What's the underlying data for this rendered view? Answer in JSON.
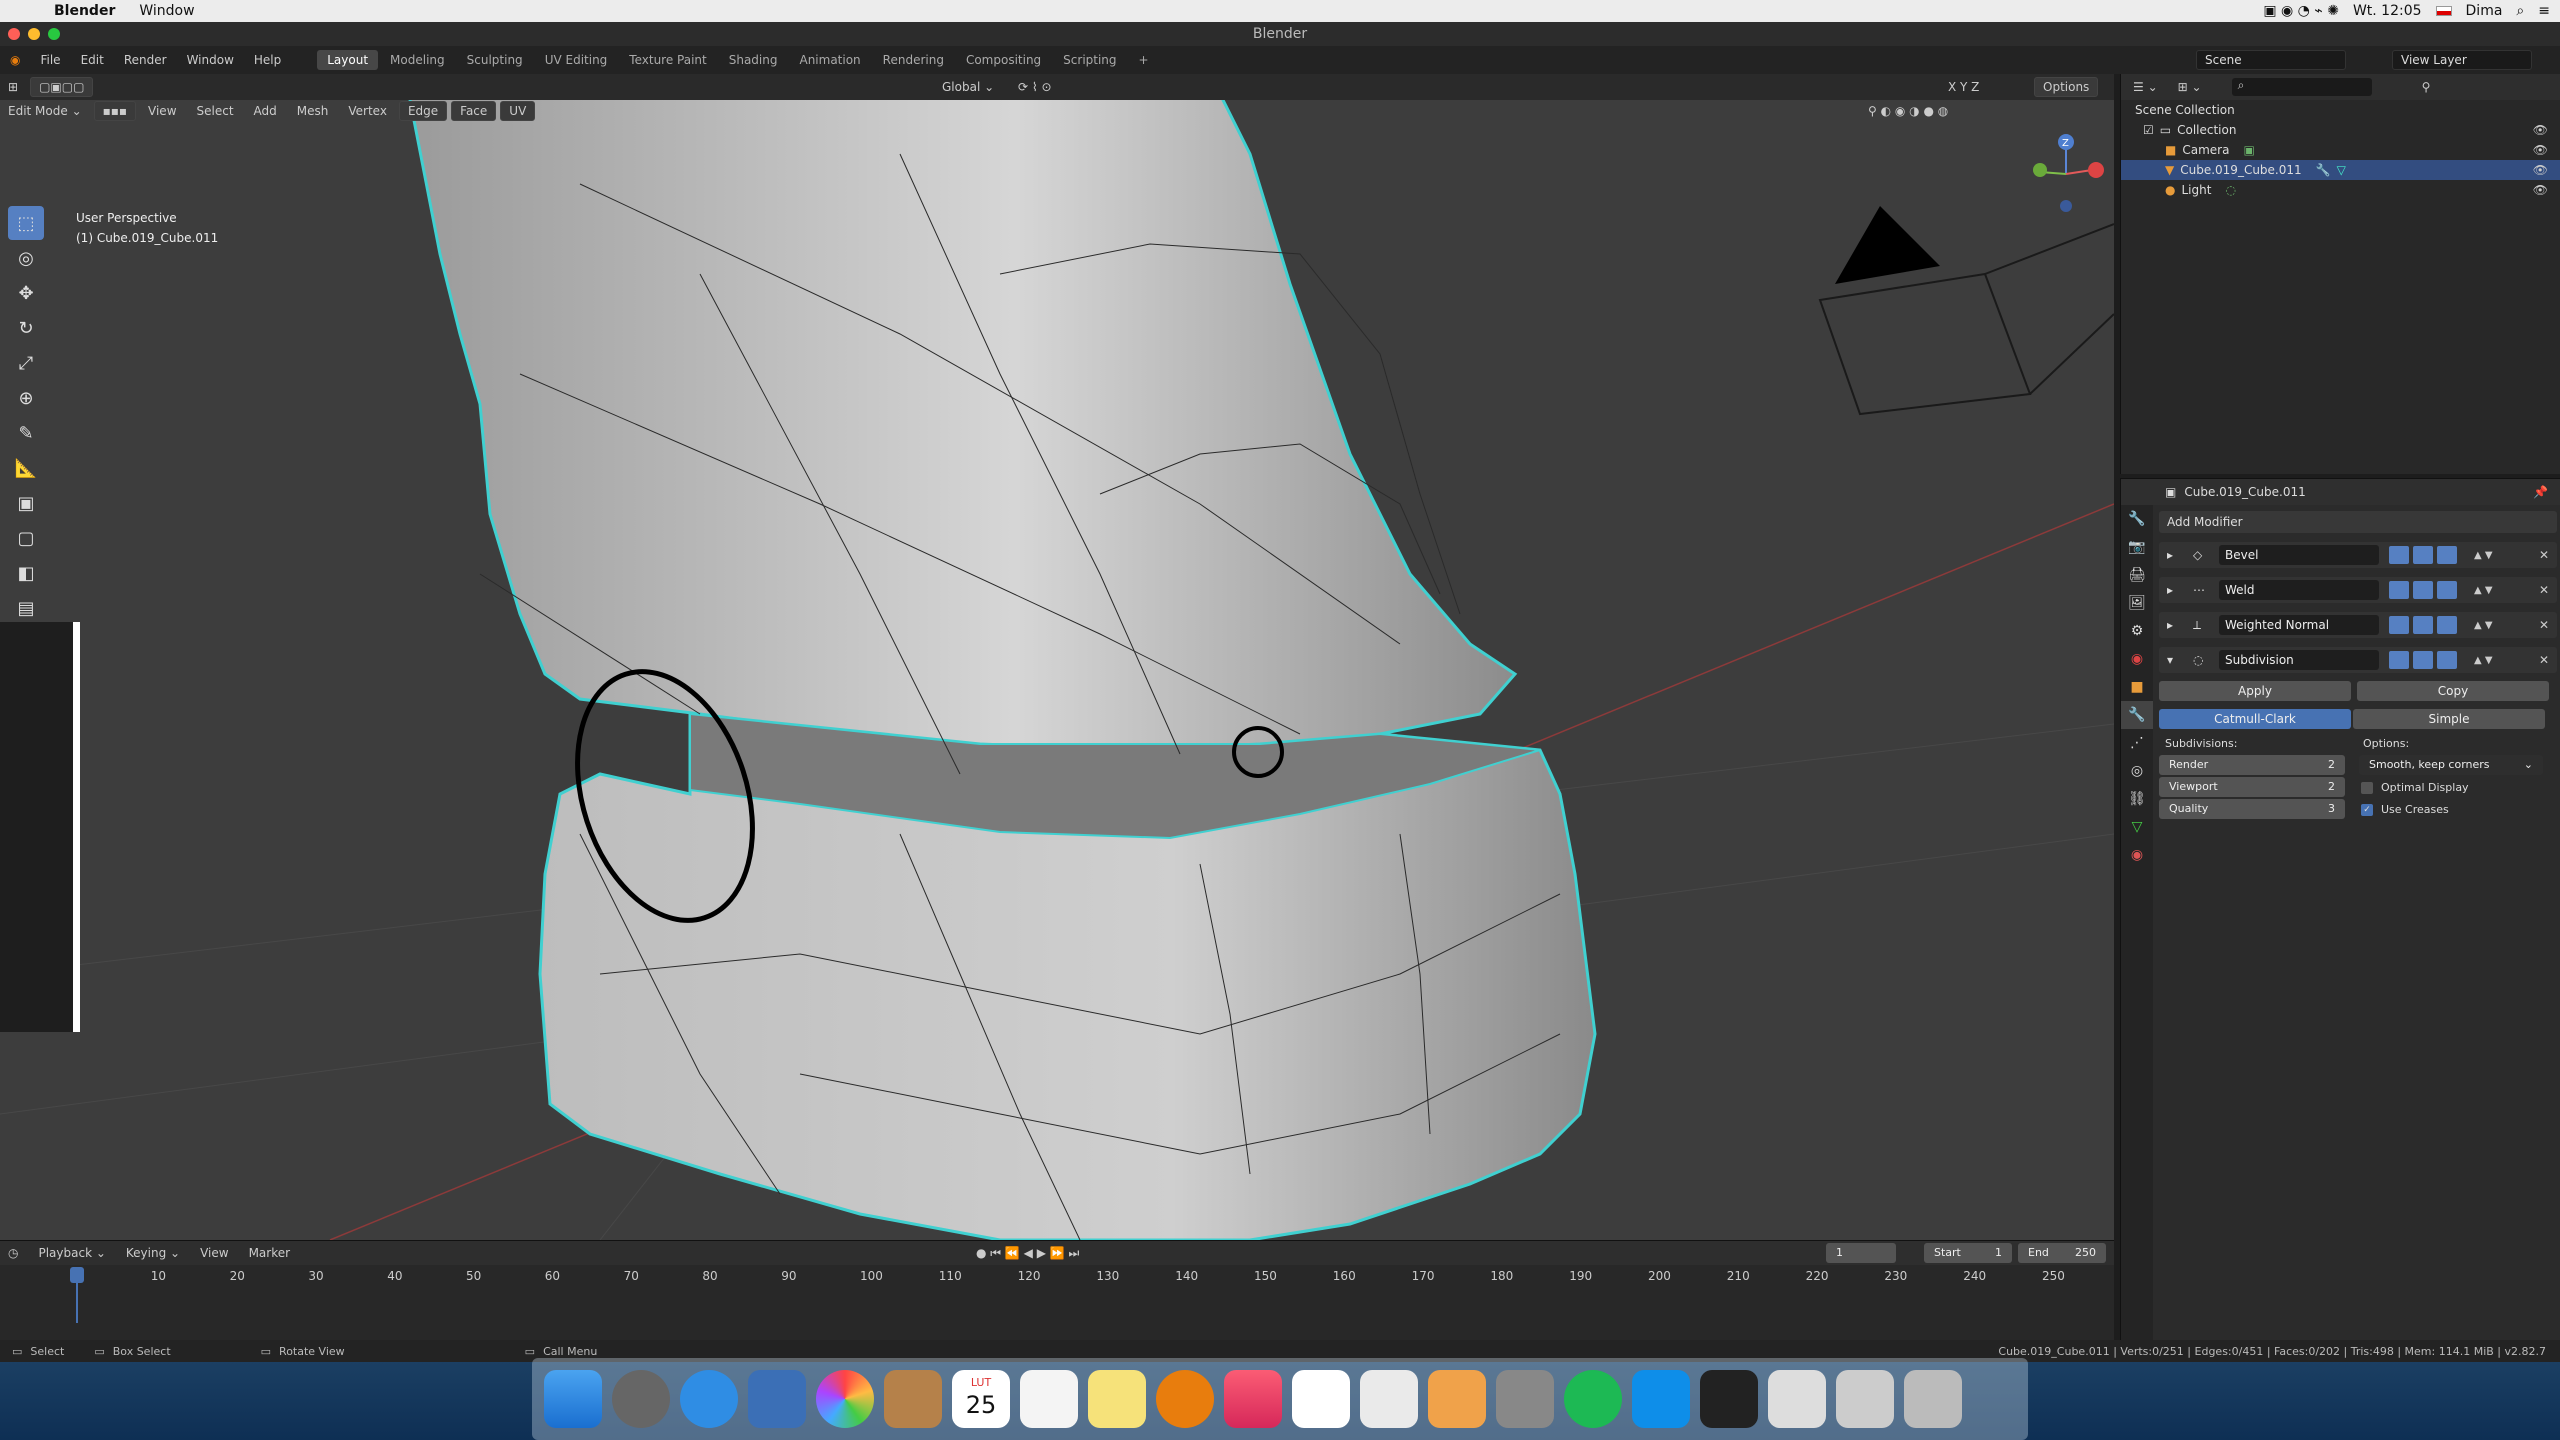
{
  "mac_menubar": {
    "app": "Blender",
    "items": [
      "Window"
    ],
    "clock": "Wt. 12:05",
    "user": "Dima"
  },
  "window": {
    "title": "Blender"
  },
  "menu": [
    "File",
    "Edit",
    "Render",
    "Window",
    "Help"
  ],
  "workspaces": [
    "Layout",
    "Modeling",
    "Sculpting",
    "UV Editing",
    "Texture Paint",
    "Shading",
    "Animation",
    "Rendering",
    "Compositing",
    "Scripting",
    "+"
  ],
  "scene": {
    "label": "Scene",
    "view_layer": "View Layer"
  },
  "viewport": {
    "mode": "Edit Mode",
    "menus": [
      "View",
      "Select",
      "Add",
      "Mesh",
      "Vertex",
      "Edge",
      "Face",
      "UV"
    ],
    "transform": "Global",
    "options": "Options",
    "info_line1": "User Perspective",
    "info_line2": "(1) Cube.019_Cube.011",
    "gizmo": [
      "Z",
      "Y",
      "X"
    ]
  },
  "outliner": {
    "root": "Scene Collection",
    "items": [
      {
        "label": "Collection"
      },
      {
        "label": "Camera"
      },
      {
        "label": "Cube.019_Cube.011",
        "selected": true
      },
      {
        "label": "Light"
      }
    ]
  },
  "properties": {
    "object": "Cube.019_Cube.011",
    "add_modifier": "Add Modifier",
    "modifiers": [
      "Bevel",
      "Weld",
      "Weighted Normal",
      "Subdivision"
    ],
    "apply": "Apply",
    "copy": "Copy",
    "algo": [
      "Catmull-Clark",
      "Simple"
    ],
    "subdivisions_label": "Subdivisions:",
    "options_label": "Options:",
    "render_label": "Render",
    "render_value": "2",
    "viewport_label": "Viewport",
    "viewport_value": "2",
    "quality_label": "Quality",
    "quality_value": "3",
    "uv_smooth": "Smooth, keep corners",
    "optimal_display": "Optimal Display",
    "use_creases": "Use Creases"
  },
  "timeline": {
    "menus": [
      "Playback",
      "Keying",
      "View",
      "Marker"
    ],
    "current": "1",
    "start_label": "Start",
    "start": "1",
    "end_label": "End",
    "end": "250",
    "ticks": [
      "1",
      "10",
      "20",
      "30",
      "40",
      "50",
      "60",
      "70",
      "80",
      "90",
      "100",
      "110",
      "120",
      "130",
      "140",
      "150",
      "160",
      "170",
      "180",
      "190",
      "200",
      "210",
      "220",
      "230",
      "240",
      "250"
    ]
  },
  "status": {
    "select": "Select",
    "box": "Box Select",
    "rotate": "Rotate View",
    "call": "Call Menu",
    "stats": "Cube.019_Cube.011 | Verts:0/251 | Edges:0/451 | Faces:0/202 | Tris:498 | Mem: 114.1 MiB | v2.82.7"
  },
  "dock": {
    "calendar_month": "LUT",
    "calendar_day": "25"
  }
}
